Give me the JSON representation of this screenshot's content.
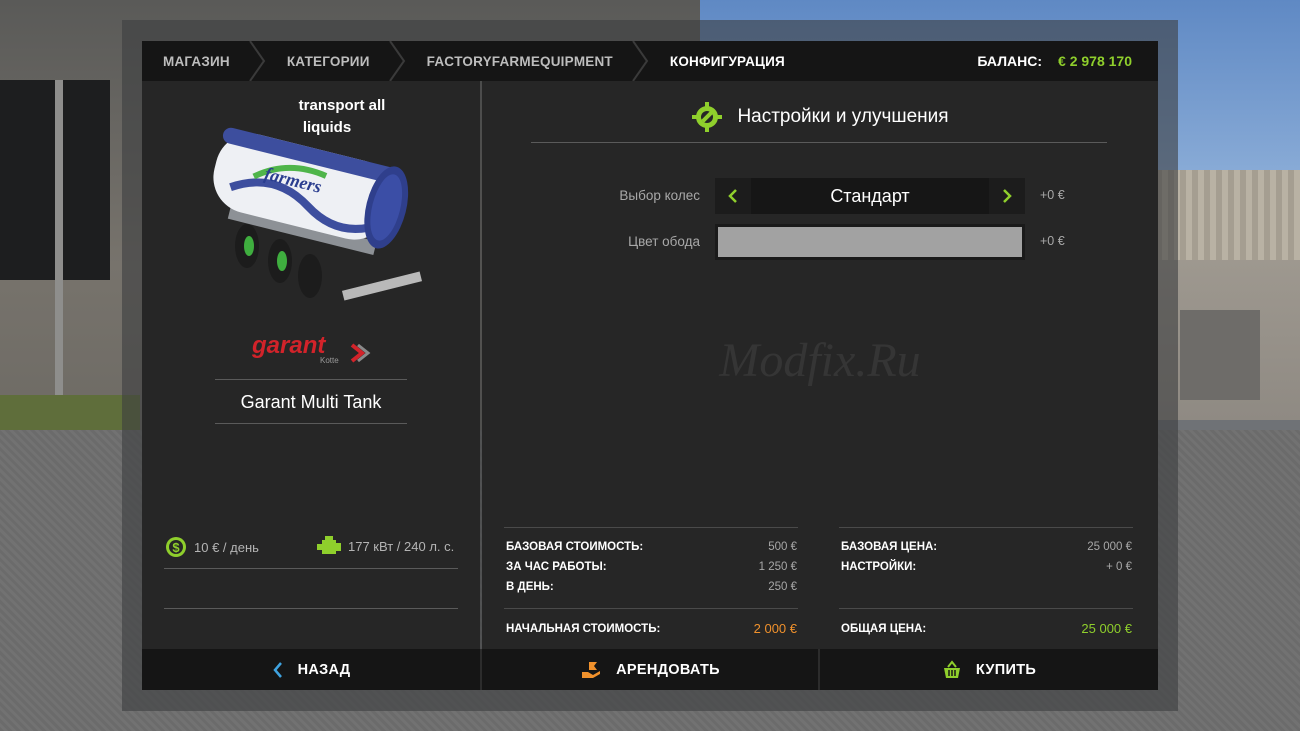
{
  "breadcrumbs": [
    "МАГАЗИН",
    "КАТЕГОРИИ",
    "FACTORYFARMEQUIPMENT",
    "КОНФИГУРАЦИЯ"
  ],
  "balance": {
    "label": "БАЛАНС:",
    "value": "€ 2 978 170"
  },
  "vehicle": {
    "promo_line1": "transport  all",
    "promo_line2": "liquids",
    "tank_logo": "farmers",
    "brand": "garant",
    "brand_sub": "Kotte",
    "name": "Garant Multi Tank",
    "stats": [
      {
        "icon": "dollar-gear-icon",
        "text": "10 € / день"
      },
      {
        "icon": "engine-icon",
        "text": "177 кВт / 240 л. с."
      }
    ]
  },
  "settings": {
    "title": "Настройки и улучшения",
    "options": [
      {
        "label": "Выбор колес",
        "value": "Стандарт",
        "cost": "+0 €"
      },
      {
        "label": "Цвет обода",
        "color": "#a2a2a2",
        "cost": "+0 €"
      }
    ],
    "watermark": "Modfix.Ru"
  },
  "prices": {
    "left": [
      {
        "label": "БАЗОВАЯ СТОИМОСТЬ:",
        "value": "500 €"
      },
      {
        "label": "ЗА ЧАС РАБОТЫ:",
        "value": "1 250 €"
      },
      {
        "label": "В ДЕНЬ:",
        "value": "250 €"
      }
    ],
    "left_total": {
      "label": "НАЧАЛЬНАЯ СТОИМОСТЬ:",
      "value": "2 000 €"
    },
    "right": [
      {
        "label": "БАЗОВАЯ ЦЕНА:",
        "value": "25 000 €"
      },
      {
        "label": "НАСТРОЙКИ:",
        "value": "+ 0 €"
      }
    ],
    "right_total": {
      "label": "ОБЩАЯ ЦЕНА:",
      "value": "25 000 €"
    }
  },
  "buttons": {
    "back": "НАЗАД",
    "lease": "АРЕНДОВАТЬ",
    "buy": "КУПИТЬ"
  },
  "colors": {
    "accent_green": "#8fcf2c",
    "accent_orange": "#f0912c",
    "back_blue": "#3fa3e0"
  }
}
